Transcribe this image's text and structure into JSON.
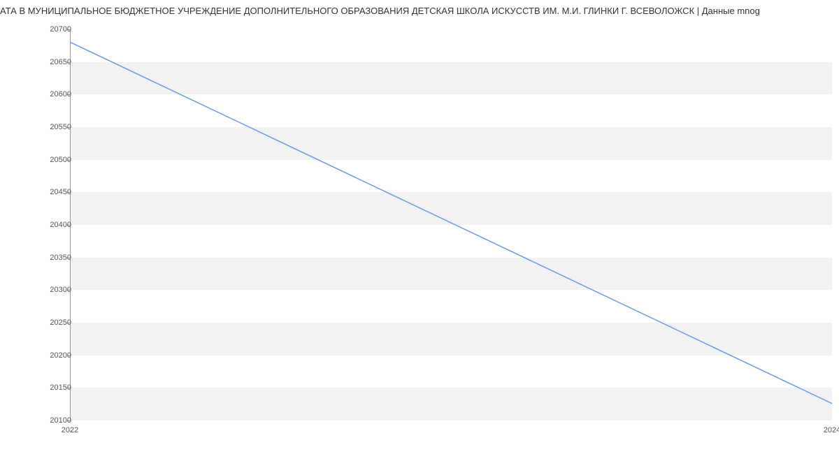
{
  "chart_data": {
    "type": "line",
    "title": "АТА В МУНИЦИПАЛЬНОЕ БЮДЖЕТНОЕ УЧРЕЖДЕНИЕ ДОПОЛНИТЕЛЬНОГО ОБРАЗОВАНИЯ ДЕТСКАЯ ШКОЛА ИСКУССТВ ИМ. М.И. ГЛИНКИ Г. ВСЕВОЛОЖСК | Данные mnog",
    "x": [
      2022,
      2024
    ],
    "values": [
      20680,
      20126
    ],
    "xlabel": "",
    "ylabel": "",
    "xlim": [
      2022,
      2024
    ],
    "ylim": [
      20100,
      20700
    ],
    "y_ticks": [
      20100,
      20150,
      20200,
      20250,
      20300,
      20350,
      20400,
      20450,
      20500,
      20550,
      20600,
      20650,
      20700
    ],
    "x_ticks": [
      2022,
      2024
    ],
    "line_color": "#6b9be8",
    "grid_on": true
  }
}
